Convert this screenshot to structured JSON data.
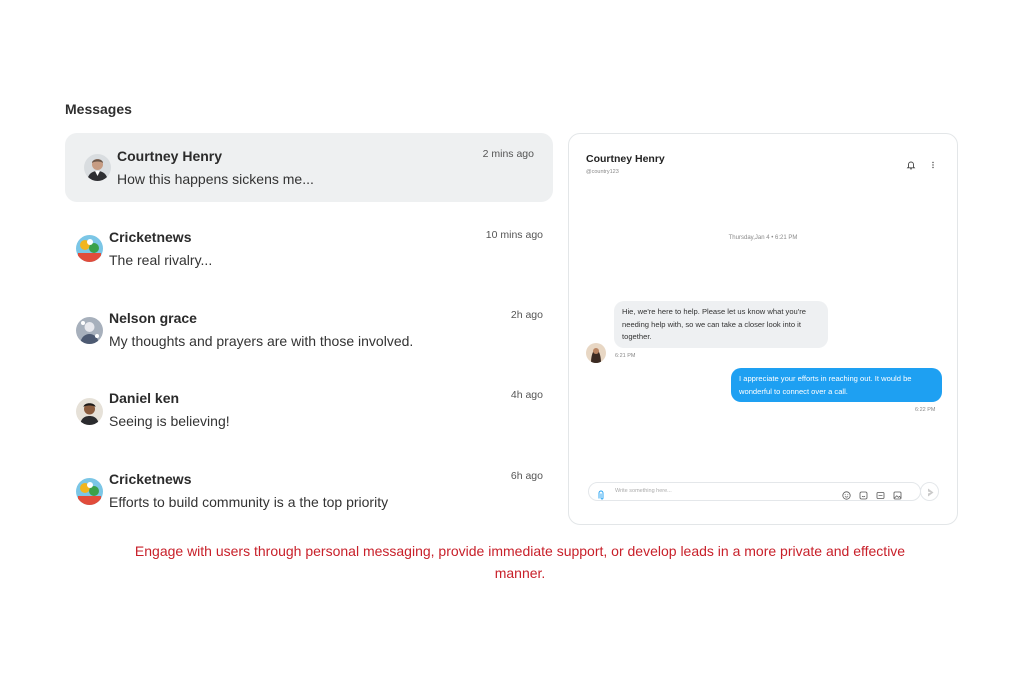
{
  "section_title": "Messages",
  "conversations": [
    {
      "name": "Courtney Henry",
      "preview": "How this happens sickens me...",
      "time": "2 mins ago",
      "avatar": "avatar-courtney"
    },
    {
      "name": "Cricketnews",
      "preview": "The real rivalry...",
      "time": "10 mins ago",
      "avatar": "avatar-cricketnews"
    },
    {
      "name": "Nelson grace",
      "preview": "My thoughts and prayers are with those involved.",
      "time": "2h ago",
      "avatar": "avatar-nelson"
    },
    {
      "name": "Daniel ken",
      "preview": "Seeing is believing!",
      "time": "4h ago",
      "avatar": "avatar-daniel"
    },
    {
      "name": "Cricketnews",
      "preview": "Efforts to build community is a the top priority",
      "time": "6h ago",
      "avatar": "avatar-cricketnews"
    }
  ],
  "chat": {
    "name": "Courtney Henry",
    "handle": "@country123",
    "date_separator": "Thursday,Jan 4  •  6:21 PM",
    "messages": [
      {
        "direction": "in",
        "text": "Hie, we're here to help. Please let us know what you're needing help with, so we can take a closer look into it together.",
        "time": "6:21 PM"
      },
      {
        "direction": "out",
        "text": "I appreciate your efforts in reaching out. It would be wonderful to connect over a call.",
        "time": "6:22 PM"
      }
    ],
    "composer_placeholder": "Write something here..."
  },
  "caption": "Engage with users through personal messaging, provide immediate support, or develop leads in a more private and effective manner.",
  "colors": {
    "accent": "#1ea0f2",
    "caption": "#c8202a",
    "active_row": "#eef0f1"
  }
}
